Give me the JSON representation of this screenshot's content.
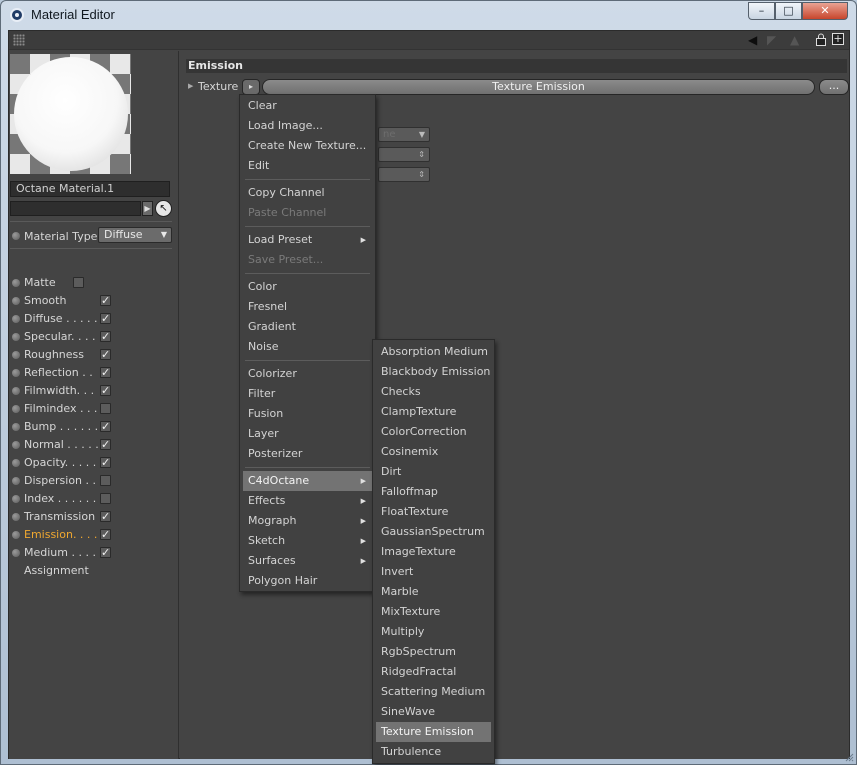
{
  "window": {
    "title": "Material Editor",
    "minimize": "–",
    "maximize": "□",
    "close": "✕"
  },
  "toolbar": {
    "back_icon": "◀",
    "forward_icon": "◤",
    "up_icon": "▲",
    "lock_icon": "🔒",
    "new_icon": "+"
  },
  "material": {
    "name": "Octane Material.1",
    "link_value": "",
    "type_label": "Material Type",
    "type_value": "Diffuse"
  },
  "channels": [
    {
      "label": "Matte",
      "checked": false,
      "active": false
    },
    {
      "label": "Smooth",
      "checked": true,
      "active": false
    },
    {
      "label": "Diffuse . . . . .",
      "checked": true,
      "active": false
    },
    {
      "label": "Specular. . . .",
      "checked": true,
      "active": false
    },
    {
      "label": "Roughness",
      "checked": true,
      "active": false
    },
    {
      "label": "Reflection . .",
      "checked": true,
      "active": false
    },
    {
      "label": "Filmwidth. . .",
      "checked": true,
      "active": false
    },
    {
      "label": "Filmindex . . .",
      "checked": false,
      "active": false
    },
    {
      "label": "Bump . . . . . .",
      "checked": true,
      "active": false
    },
    {
      "label": "Normal . . . . .",
      "checked": true,
      "active": false
    },
    {
      "label": "Opacity. . . . .",
      "checked": true,
      "active": false
    },
    {
      "label": "Dispersion . .",
      "checked": false,
      "active": false
    },
    {
      "label": "Index . . . . . .",
      "checked": false,
      "active": false
    },
    {
      "label": "Transmission",
      "checked": true,
      "active": false
    },
    {
      "label": "Emission. . . .",
      "checked": true,
      "active": true
    },
    {
      "label": "Medium . . . . .",
      "checked": true,
      "active": false
    }
  ],
  "assignment_label": "Assignment",
  "emission": {
    "section_title": "Emission",
    "texture_label": "Texture",
    "texture_button": "▸",
    "texture_value": "Texture Emission",
    "more_button": "..."
  },
  "hidden_controls": {
    "select_fragment": "ne"
  },
  "context_menu": {
    "groups": [
      [
        {
          "label": "Clear",
          "disabled": false,
          "submenu": false
        },
        {
          "label": "Load Image...",
          "disabled": false,
          "submenu": false
        },
        {
          "label": "Create New Texture...",
          "disabled": false,
          "submenu": false
        },
        {
          "label": "Edit",
          "disabled": false,
          "submenu": false
        }
      ],
      [
        {
          "label": "Copy Channel",
          "disabled": false,
          "submenu": false
        },
        {
          "label": "Paste Channel",
          "disabled": true,
          "submenu": false
        }
      ],
      [
        {
          "label": "Load Preset",
          "disabled": false,
          "submenu": true
        },
        {
          "label": "Save Preset...",
          "disabled": true,
          "submenu": false
        }
      ],
      [
        {
          "label": "Color",
          "disabled": false,
          "submenu": false
        },
        {
          "label": "Fresnel",
          "disabled": false,
          "submenu": false
        },
        {
          "label": "Gradient",
          "disabled": false,
          "submenu": false
        },
        {
          "label": "Noise",
          "disabled": false,
          "submenu": false
        }
      ],
      [
        {
          "label": "Colorizer",
          "disabled": false,
          "submenu": false
        },
        {
          "label": "Filter",
          "disabled": false,
          "submenu": false
        },
        {
          "label": "Fusion",
          "disabled": false,
          "submenu": false
        },
        {
          "label": "Layer",
          "disabled": false,
          "submenu": false
        },
        {
          "label": "Posterizer",
          "disabled": false,
          "submenu": false
        }
      ],
      [
        {
          "label": "C4dOctane",
          "disabled": false,
          "submenu": true,
          "highlighted": true
        },
        {
          "label": "Effects",
          "disabled": false,
          "submenu": true
        },
        {
          "label": "Mograph",
          "disabled": false,
          "submenu": true
        },
        {
          "label": "Sketch",
          "disabled": false,
          "submenu": true
        },
        {
          "label": "Surfaces",
          "disabled": false,
          "submenu": true
        },
        {
          "label": "Polygon Hair",
          "disabled": false,
          "submenu": false
        }
      ]
    ]
  },
  "octane_submenu": {
    "items": [
      "Absorption Medium",
      "Blackbody Emission",
      "Checks",
      "ClampTexture",
      "ColorCorrection",
      "Cosinemix",
      "Dirt",
      "Falloffmap",
      "FloatTexture",
      "GaussianSpectrum",
      "ImageTexture",
      "Invert",
      "Marble",
      "MixTexture",
      "Multiply",
      "RgbSpectrum",
      "RidgedFractal",
      "Scattering Medium",
      "SineWave",
      "Texture Emission",
      "Turbulence"
    ],
    "highlighted": "Texture Emission"
  },
  "colors": {
    "panel_bg": "#444444",
    "active_channel": "#f0a830",
    "menu_highlight": "#737373",
    "titlebar": "#b9c9da"
  }
}
